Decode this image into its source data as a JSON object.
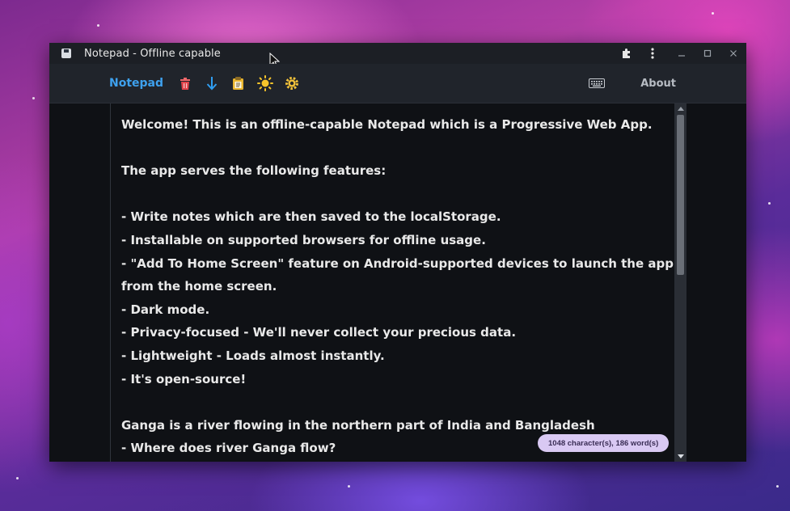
{
  "window": {
    "title": "Notepad - Offline capable"
  },
  "navbar": {
    "brand": "Notepad",
    "about_label": "About",
    "icons": [
      "delete-icon",
      "download-icon",
      "clipboard-icon",
      "theme-sun-icon",
      "settings-gear-icon",
      "keyboard-icon"
    ]
  },
  "note": {
    "lines": [
      "Welcome! This is an offline-capable Notepad which is a Progressive Web App.",
      "",
      "The app serves the following features:",
      "",
      "- Write notes which are then saved to the localStorage.",
      "- Installable on supported browsers for offline usage.",
      "- \"Add To Home Screen\" feature on Android-supported devices to launch the app",
      "from the home screen.",
      "- Dark mode.",
      "- Privacy-focused - We'll never collect your precious data.",
      "- Lightweight - Loads almost instantly.",
      "- It's open-source!",
      "",
      "Ganga is a river flowing in the northern part of India and Bangladesh",
      "- Where does river Ganga flow?"
    ]
  },
  "status": {
    "count_label": "1048 character(s), 186 word(s)"
  },
  "colors": {
    "brand": "#3ea1ee",
    "badge_bg": "#d9c9f3",
    "editor_bg": "#0f1115",
    "navbar_bg": "#20242b"
  }
}
